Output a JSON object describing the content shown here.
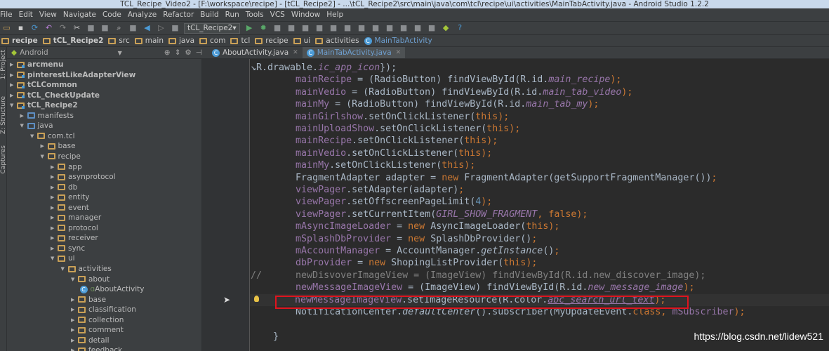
{
  "title": "TCL_Recipe_Video2 - [F:\\workspace\\recipe] - [tCL_Recipe2] - ...\\tCL_Recipe2\\src\\main\\java\\com\\tcl\\recipe\\ui\\activities\\MainTabActivity.java - Android Studio 1.2.2",
  "menu": [
    "File",
    "Edit",
    "View",
    "Navigate",
    "Code",
    "Analyze",
    "Refactor",
    "Build",
    "Run",
    "Tools",
    "VCS",
    "Window",
    "Help"
  ],
  "toolbar": {
    "run_config": "tCL_Recipe2",
    "icons": [
      "open-icon",
      "save-icon",
      "sync-icon",
      "undo-icon",
      "redo-icon",
      "cut-icon",
      "copy-icon",
      "paste-icon",
      "find-icon",
      "replace-icon",
      "back-icon",
      "forward-icon",
      "make-icon",
      "run-icon",
      "debug-icon",
      "attach-icon",
      "stop-icon",
      "vcs-update-icon",
      "vcs-commit-icon",
      "vcs-icon",
      "vcs-history-icon",
      "revert-icon",
      "project-structure-icon",
      "sdk-icon",
      "avd-icon",
      "sync-gradle-icon",
      "android-monitor-icon",
      "android-icon",
      "help-icon"
    ]
  },
  "breadcrumb": [
    "recipe",
    "tCL_Recipe2",
    "src",
    "main",
    "java",
    "com",
    "tcl",
    "recipe",
    "ui",
    "activities",
    "MainTabActivity"
  ],
  "side_strip": [
    "1: Project",
    "Z: Structure",
    "Captures"
  ],
  "project_panel": {
    "view": "Android"
  },
  "tabs": [
    {
      "label": "AboutActivity.java",
      "active": false
    },
    {
      "label": "MainTabActivity.java",
      "active": true
    }
  ],
  "tree": [
    {
      "label": "arcmenu",
      "level": 0,
      "open": false,
      "bold": true,
      "type": "module"
    },
    {
      "label": "pinterestLikeAdapterView",
      "level": 0,
      "open": false,
      "bold": true,
      "type": "module"
    },
    {
      "label": "tCLCommon",
      "level": 0,
      "open": false,
      "bold": true,
      "type": "module"
    },
    {
      "label": "tCL_CheckUpdate",
      "level": 0,
      "open": false,
      "bold": true,
      "type": "module"
    },
    {
      "label": "tCL_Recipe2",
      "level": 0,
      "open": true,
      "bold": true,
      "type": "module"
    },
    {
      "label": "manifests",
      "level": 1,
      "open": false,
      "type": "blue"
    },
    {
      "label": "java",
      "level": 1,
      "open": true,
      "type": "blue"
    },
    {
      "label": "com.tcl",
      "level": 2,
      "open": true,
      "type": "pkg"
    },
    {
      "label": "base",
      "level": 3,
      "open": false,
      "type": "pkg"
    },
    {
      "label": "recipe",
      "level": 3,
      "open": true,
      "type": "pkg"
    },
    {
      "label": "app",
      "level": 4,
      "open": false,
      "type": "pkg"
    },
    {
      "label": "asynprotocol",
      "level": 4,
      "open": false,
      "type": "pkg"
    },
    {
      "label": "db",
      "level": 4,
      "open": false,
      "type": "pkg"
    },
    {
      "label": "entity",
      "level": 4,
      "open": false,
      "type": "pkg"
    },
    {
      "label": "event",
      "level": 4,
      "open": false,
      "type": "pkg"
    },
    {
      "label": "manager",
      "level": 4,
      "open": false,
      "type": "pkg"
    },
    {
      "label": "protocol",
      "level": 4,
      "open": false,
      "type": "pkg"
    },
    {
      "label": "receiver",
      "level": 4,
      "open": false,
      "type": "pkg"
    },
    {
      "label": "sync",
      "level": 4,
      "open": false,
      "type": "pkg"
    },
    {
      "label": "ui",
      "level": 4,
      "open": true,
      "type": "pkg"
    },
    {
      "label": "activities",
      "level": 5,
      "open": true,
      "type": "pkg"
    },
    {
      "label": "about",
      "level": 6,
      "open": true,
      "type": "pkg"
    },
    {
      "label": "AboutActivity",
      "level": 7,
      "type": "class"
    },
    {
      "label": "base",
      "level": 6,
      "open": false,
      "type": "pkg"
    },
    {
      "label": "classification",
      "level": 6,
      "open": false,
      "type": "pkg"
    },
    {
      "label": "collection",
      "level": 6,
      "open": false,
      "type": "pkg"
    },
    {
      "label": "comment",
      "level": 6,
      "open": false,
      "type": "pkg"
    },
    {
      "label": "detail",
      "level": 6,
      "open": false,
      "type": "pkg"
    },
    {
      "label": "feedback",
      "level": 6,
      "open": false,
      "type": "pkg"
    }
  ],
  "code": [
    {
      "indent": 0,
      "segs": [
        [
          "↘R.drawable.",
          "p"
        ],
        [
          "ic_app_icon",
          "i"
        ],
        [
          "});",
          "p"
        ]
      ]
    },
    {
      "indent": 8,
      "segs": [
        [
          "mainRecipe",
          "f"
        ],
        [
          " = (RadioButton) findViewById(R.id.",
          "p"
        ],
        [
          "main_recipe",
          "i"
        ],
        [
          ");",
          "k"
        ]
      ]
    },
    {
      "indent": 8,
      "segs": [
        [
          "mainVedio",
          "f"
        ],
        [
          " = (RadioButton) findViewById(R.id.",
          "p"
        ],
        [
          "main_tab_video",
          "i"
        ],
        [
          ");",
          "k"
        ]
      ]
    },
    {
      "indent": 8,
      "segs": [
        [
          "mainMy",
          "f"
        ],
        [
          " = (RadioButton) findViewById(R.id.",
          "p"
        ],
        [
          "main_tab_my",
          "i"
        ],
        [
          ");",
          "k"
        ]
      ]
    },
    {
      "indent": 8,
      "segs": [
        [
          "mainGirlshow",
          "f"
        ],
        [
          ".setOnClickListener(",
          "p"
        ],
        [
          "this",
          "k"
        ],
        [
          ");",
          "k"
        ]
      ]
    },
    {
      "indent": 8,
      "segs": [
        [
          "mainUploadShow",
          "f"
        ],
        [
          ".setOnClickListener(",
          "p"
        ],
        [
          "this",
          "k"
        ],
        [
          ");",
          "k"
        ]
      ]
    },
    {
      "indent": 8,
      "segs": [
        [
          "mainRecipe",
          "f"
        ],
        [
          ".setOnClickListener(",
          "p"
        ],
        [
          "this",
          "k"
        ],
        [
          ");",
          "k"
        ]
      ]
    },
    {
      "indent": 8,
      "segs": [
        [
          "mainVedio",
          "f"
        ],
        [
          ".setOnClickListener(",
          "p"
        ],
        [
          "this",
          "k"
        ],
        [
          ");",
          "k"
        ]
      ]
    },
    {
      "indent": 8,
      "segs": [
        [
          "mainMy",
          "f"
        ],
        [
          ".setOnClickListener(",
          "p"
        ],
        [
          "this",
          "k"
        ],
        [
          ");",
          "k"
        ]
      ]
    },
    {
      "indent": 8,
      "segs": [
        [
          "FragmentAdapter adapter = ",
          "p"
        ],
        [
          "new",
          "k"
        ],
        [
          " FragmentAdapter(getSupportFragmentManager())",
          "p"
        ],
        [
          ";",
          "k"
        ]
      ]
    },
    {
      "indent": 8,
      "segs": [
        [
          "viewPager",
          "f"
        ],
        [
          ".setAdapter(adapter)",
          "p"
        ],
        [
          ";",
          "k"
        ]
      ]
    },
    {
      "indent": 8,
      "segs": [
        [
          "viewPager",
          "f"
        ],
        [
          ".setOffscreenPageLimit(",
          "p"
        ],
        [
          "4",
          "n"
        ],
        [
          ");",
          "k"
        ]
      ]
    },
    {
      "indent": 8,
      "segs": [
        [
          "viewPager",
          "f"
        ],
        [
          ".setCurrentItem(",
          "p"
        ],
        [
          "GIRL_SHOW_FRAGMENT",
          "i"
        ],
        [
          ", ",
          "k"
        ],
        [
          "false",
          "k"
        ],
        [
          ");",
          "k"
        ]
      ]
    },
    {
      "indent": 8,
      "segs": [
        [
          "mAsyncImageLoader",
          "f"
        ],
        [
          " = ",
          "p"
        ],
        [
          "new",
          "k"
        ],
        [
          " AsyncImageLoader(",
          "p"
        ],
        [
          "this",
          "k"
        ],
        [
          ");",
          "k"
        ]
      ]
    },
    {
      "indent": 8,
      "segs": [
        [
          "mSplashDbProvider",
          "f"
        ],
        [
          " = ",
          "p"
        ],
        [
          "new",
          "k"
        ],
        [
          " SplashDbProvider()",
          "p"
        ],
        [
          ";",
          "k"
        ]
      ]
    },
    {
      "indent": 8,
      "segs": [
        [
          "mAccountManager",
          "f"
        ],
        [
          " = AccountManager.",
          "p"
        ],
        [
          "getInstance",
          "m"
        ],
        [
          "()",
          "p"
        ],
        [
          ";",
          "k"
        ]
      ]
    },
    {
      "indent": 8,
      "segs": [
        [
          "dbProvider",
          "f"
        ],
        [
          " = ",
          "p"
        ],
        [
          "new",
          "k"
        ],
        [
          " ShopingListProvider(",
          "p"
        ],
        [
          "this",
          "k"
        ],
        [
          ");",
          "k"
        ]
      ]
    },
    {
      "indent": 0,
      "segs": [
        [
          "//      newDisvoverImageView = (ImageView) findViewById(R.id.new_discover_image);",
          "c"
        ]
      ]
    },
    {
      "indent": 8,
      "segs": [
        [
          "newMessageImageView",
          "f"
        ],
        [
          " = (ImageView) findViewById(R.id.",
          "p"
        ],
        [
          "new_message_image",
          "i"
        ],
        [
          ");",
          "k"
        ]
      ]
    },
    {
      "indent": 8,
      "highlight": true,
      "segs": [
        [
          "newMessageImageView",
          "f"
        ],
        [
          ".setImageResource(R.color.",
          "p"
        ],
        [
          "abc_search_url_text",
          "u"
        ],
        [
          ");",
          "k"
        ]
      ]
    },
    {
      "indent": 8,
      "segs": [
        [
          "NotificationCenter.",
          "p"
        ],
        [
          "defaultCenter",
          "m"
        ],
        [
          "().subscriber(MyUpdateEvent.",
          "p"
        ],
        [
          "class",
          "k"
        ],
        [
          ", ",
          "k"
        ],
        [
          "mSubscriber",
          "f"
        ],
        [
          ");",
          "k"
        ]
      ]
    },
    {
      "indent": 0,
      "segs": []
    },
    {
      "indent": 4,
      "segs": [
        [
          "}",
          "p"
        ]
      ]
    }
  ],
  "watermark": "https://blog.csdn.net/lidew521",
  "colors": {
    "background": "#2b2b2b",
    "panel": "#3c3f41",
    "keyword": "#cc7832",
    "field": "#9876aa",
    "highlight_box": "#e0141e"
  }
}
